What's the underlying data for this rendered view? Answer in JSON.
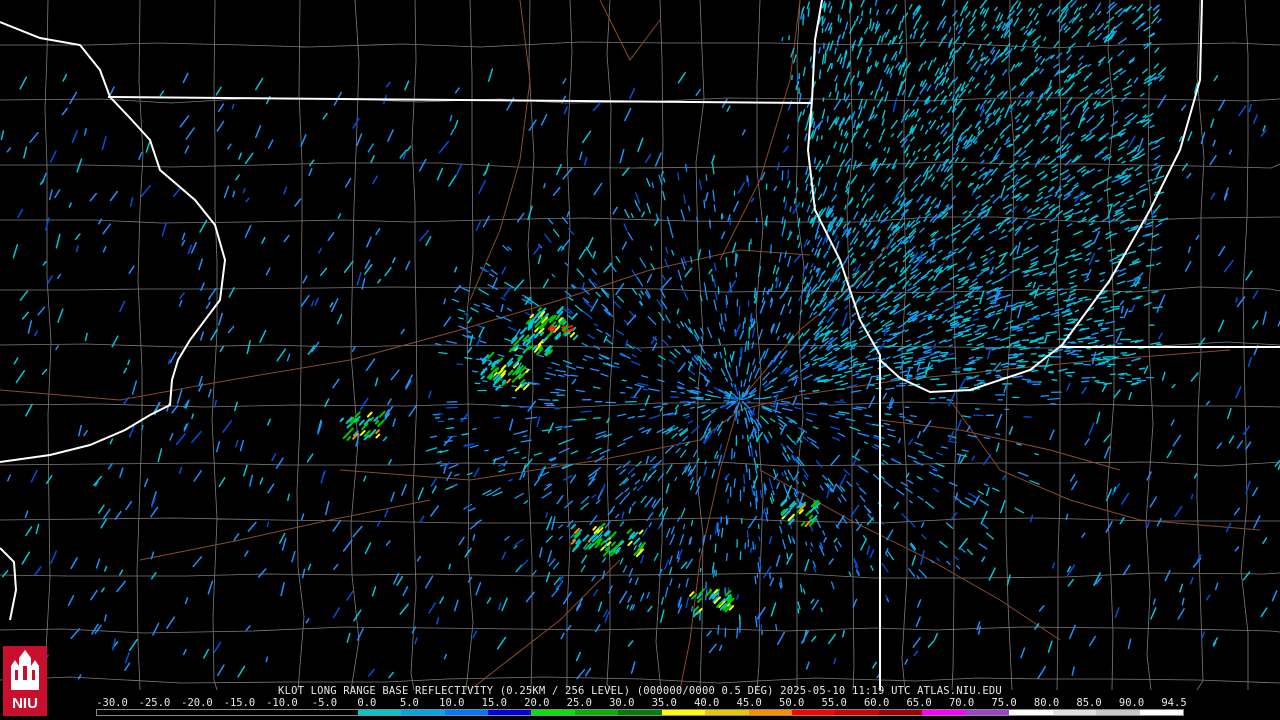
{
  "caption": "KLOT LONG RANGE BASE REFLECTIVITY (0.25KM / 256 LEVEL) (000000/0000 0.5 DEG) 2025-05-10 11:19 UTC  ATLAS.NIU.EDU",
  "logo": {
    "text": "NIU",
    "colors": {
      "red": "#c8102e",
      "white": "#ffffff"
    }
  },
  "colorbar": {
    "ticks": [
      "-30.0",
      "-25.0",
      "-20.0",
      "-15.0",
      "-10.0",
      "-5.0",
      "0.0",
      "5.0",
      "10.0",
      "15.0",
      "20.0",
      "25.0",
      "30.0",
      "35.0",
      "40.0",
      "45.0",
      "50.0",
      "55.0",
      "60.0",
      "65.0",
      "70.0",
      "75.0",
      "80.0",
      "85.0",
      "90.0",
      "94.5"
    ],
    "colors": [
      "#000000",
      "#000000",
      "#000000",
      "#000000",
      "#000000",
      "#000000",
      "#00c8c8",
      "#00a6e6",
      "#0078ff",
      "#0000e6",
      "#00e600",
      "#00b400",
      "#008000",
      "#ffff00",
      "#e6c800",
      "#ff8c00",
      "#ff0000",
      "#d40000",
      "#a00000",
      "#ff00ff",
      "#9e44c8",
      "#ffffff",
      "#e0e0e0",
      "#c8c8c8",
      "#ffffff"
    ]
  },
  "map": {
    "radar_site": "KLOT",
    "colors": {
      "state_border": "#ffffff",
      "county_border": "#8a8a8a",
      "highway": "#8b4a2b",
      "echo_light": "#00c8d8",
      "echo_mid": "#1e90ff",
      "echo_blue": "#0050e0",
      "echo_green": "#00c800",
      "echo_yellow": "#ffff00",
      "echo_orange": "#ff8c00",
      "echo_red": "#ff2000"
    }
  }
}
